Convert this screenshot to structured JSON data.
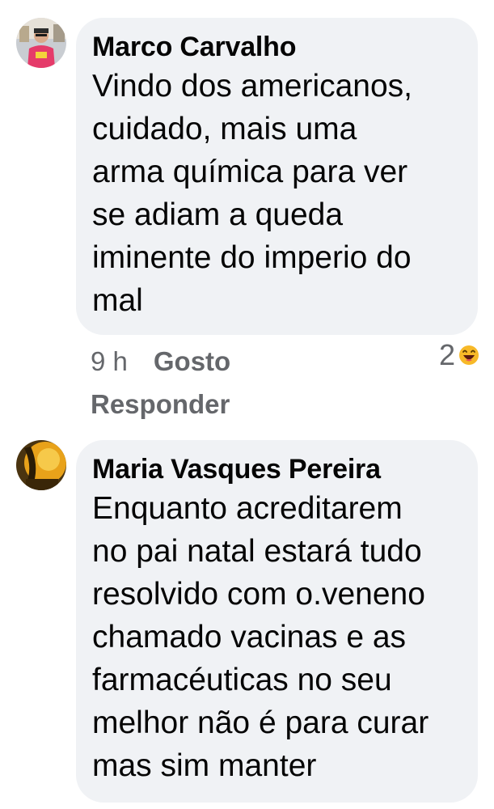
{
  "comments": [
    {
      "author": "Marco Carvalho",
      "text": "Vindo dos americanos,\ncuidado, mais uma\narma química para ver\nse adiam a queda\niminente do imperio do\nmal",
      "time": "9 h",
      "like_label": "Gosto",
      "reply_label": "Responder",
      "reaction_count": "2",
      "reaction_icon": "laughing-emoji-icon"
    },
    {
      "author": "Maria Vasques Pereira",
      "text": "Enquanto acreditarem\nno pai natal estará tudo\nresolvido com o.veneno\nchamado vacinas e as\nfarmacéuticas no seu\nmelhor não é para curar\nmas sim manter"
    }
  ],
  "colors": {
    "bubble": "#f0f2f5",
    "text": "#050505",
    "secondary": "#65676b"
  }
}
